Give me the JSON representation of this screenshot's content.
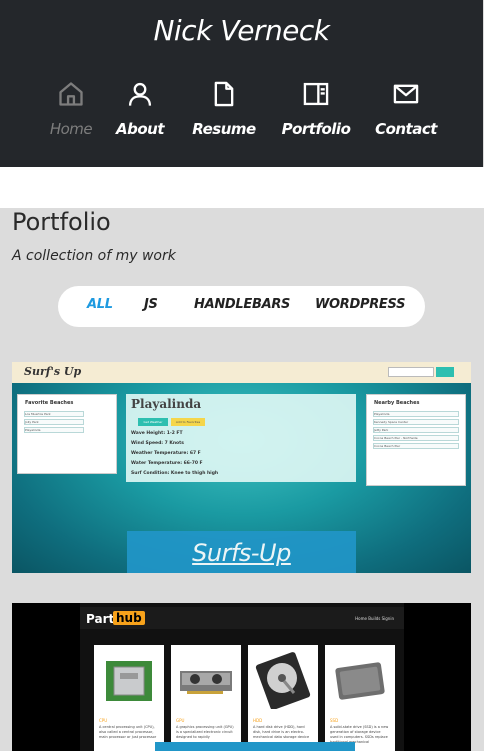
{
  "site": {
    "title": "Nick Verneck"
  },
  "nav": {
    "items": [
      {
        "label": "Home",
        "icon": "home-icon",
        "active": true
      },
      {
        "label": "About",
        "icon": "user-icon",
        "active": false
      },
      {
        "label": "Resume",
        "icon": "file-icon",
        "active": false
      },
      {
        "label": "Portfolio",
        "icon": "book-open-icon",
        "active": false
      },
      {
        "label": "Contact",
        "icon": "mail-icon",
        "active": false
      }
    ]
  },
  "portfolio": {
    "title": "Portfolio",
    "subtitle": "A collection of my work",
    "filters": [
      {
        "label": "ALL",
        "active": true
      },
      {
        "label": "JS",
        "active": false
      },
      {
        "label": "HANDLEBARS",
        "active": false
      },
      {
        "label": "WORDPRESS",
        "active": false
      }
    ],
    "projects": [
      {
        "name": "Surfs-Up",
        "screenshot": {
          "brand": "Surf's Up",
          "left_panel_title": "Favorite Beaches",
          "left_panel_rows": [
            "Los Muertos Park",
            "Jolly Park",
            "Playalinda"
          ],
          "main_title": "Playalinda",
          "button_1": "Get Weather",
          "button_2": "Add to Favorites",
          "lines": [
            "Wave Height: 1-2 FT",
            "Wind Speed: 7 Knots",
            "Weather Temperature: 67 F",
            "Water Temperature: 66-70 F",
            "Surf Condition: Knee to thigh high"
          ],
          "right_panel_title": "Nearby Beaches",
          "right_panel_rows": [
            "Playalinda",
            "Kennedy Space Center",
            "Jetty Park",
            "Cocoa Beach Pier - Northside",
            "Cocoa Beach Pier"
          ]
        }
      },
      {
        "name": "PartHub",
        "screenshot": {
          "logo_part": "Part",
          "logo_hub": "hub",
          "links": "Home   Builds   Signin",
          "cards": [
            {
              "category": "CPU",
              "text": "A central processing unit (CPU), also called a central processor, main processor or just processor"
            },
            {
              "category": "GPU",
              "text": "A graphics processing unit (GPU) is a specialized electronic circuit designed to rapidly"
            },
            {
              "category": "HDD",
              "text": "A hard disk drive (HDD), hard disk, hard drive is an electro-mechanical data storage device"
            },
            {
              "category": "SSD",
              "text": "A solid-state drive (SSD) is a new generation of storage device used in computers. SSDs replace traditional mechanical"
            }
          ]
        }
      }
    ]
  }
}
